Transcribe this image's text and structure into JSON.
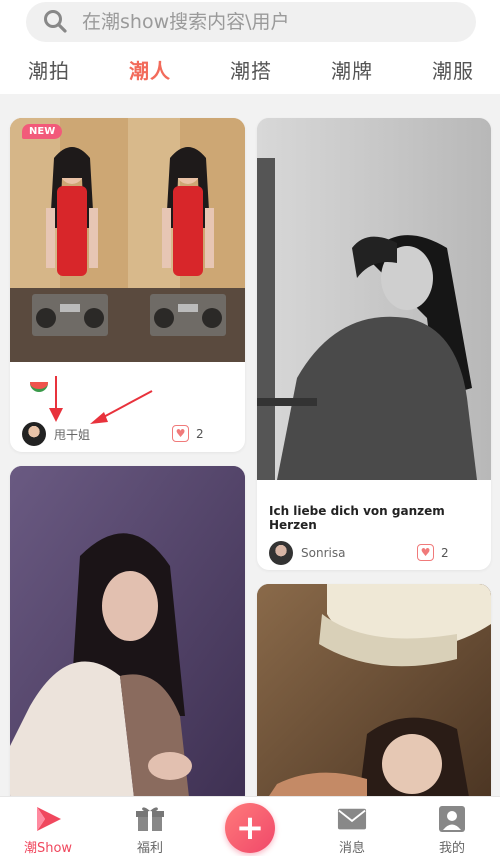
{
  "search": {
    "placeholder": "在潮show搜索内容\\用户"
  },
  "tabs": [
    {
      "label": "潮拍"
    },
    {
      "label": "潮人"
    },
    {
      "label": "潮搭"
    },
    {
      "label": "潮牌"
    },
    {
      "label": "潮服"
    }
  ],
  "active_tab": "潮人",
  "feed": {
    "card1": {
      "badge": "NEW",
      "author": "甩干姐",
      "likes": "2"
    },
    "card2": {
      "title": "Ich liebe dich von ganzem Herzen",
      "author": "Sonrisa",
      "likes": "2"
    }
  },
  "bottom_nav": {
    "home": "潮Show",
    "welfare": "福利",
    "add": "+",
    "messages": "消息",
    "mine": "我的"
  },
  "colors": {
    "accent": "#f26b5b",
    "brand_pink": "#f0486a"
  }
}
